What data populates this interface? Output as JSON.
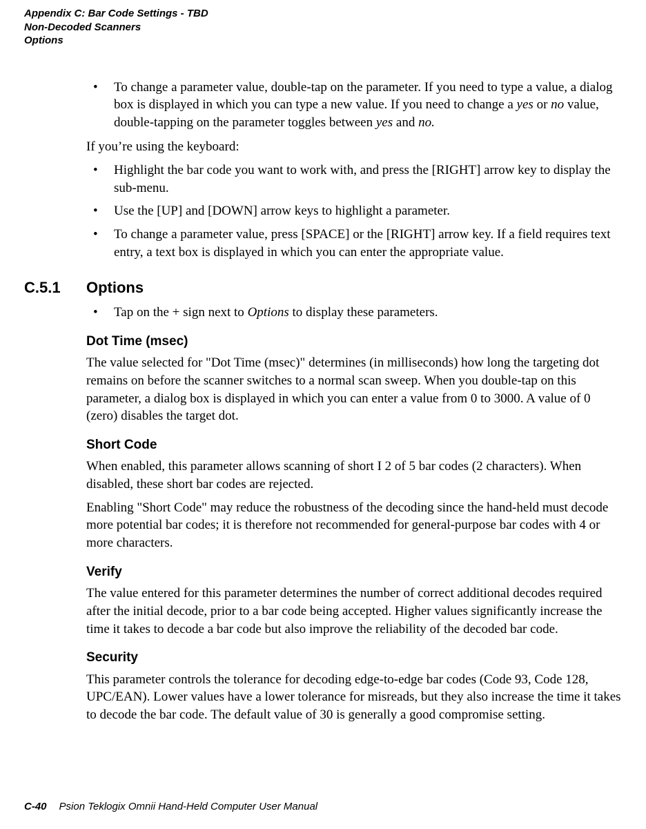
{
  "header": {
    "line1": "Appendix C: Bar Code Settings - TBD",
    "line2": "Non-Decoded Scanners",
    "line3": "Options"
  },
  "body": {
    "top_bullets": [
      {
        "pre": "To change a parameter value, double-tap on the parameter. If you need to type a value, a dialog box is displayed in which you can type a new value. If you need to change a ",
        "em1": "yes",
        "mid1": " or ",
        "em2": "no",
        "mid2": " value, double-tapping on the parameter toggles between ",
        "em3": "yes",
        "mid3": " and ",
        "em4": "no.",
        "post": ""
      }
    ],
    "keyboard_intro": "If you’re using the keyboard:",
    "keyboard_bullets": [
      "Highlight the bar code you want to work with, and press the [RIGHT] arrow key to display the sub-menu.",
      "Use the [UP] and [DOWN] arrow keys to highlight a parameter.",
      "To change a parameter value, press [SPACE] or the [RIGHT] arrow key. If a field requires text entry, a text box is displayed in which you can enter the appropriate value."
    ]
  },
  "section": {
    "number": "C.5.1",
    "title": "Options",
    "intro_bullet": {
      "pre": "Tap on the + sign next to ",
      "em": "Options",
      "post": " to display these parameters."
    },
    "dot_time": {
      "heading": "Dot Time (msec)",
      "para": "The value selected for \"Dot Time (msec)\" determines (in milliseconds) how long the targeting dot remains on before the scanner switches to a normal scan sweep. When you double-tap on this parameter, a dialog box is displayed in which you can enter a value from 0 to 3000. A value of 0 (zero) disables the target dot."
    },
    "short_code": {
      "heading": "Short Code",
      "para1": "When enabled, this parameter allows scanning of short  I 2 of 5 bar codes (2 characters). When disabled, these short bar codes are rejected.",
      "para2": "Enabling \"Short Code\" may reduce the robustness of the decoding since the hand-held must decode more potential bar codes; it is therefore not recommended for general-purpose bar codes with 4 or more characters."
    },
    "verify": {
      "heading": "Verify",
      "para": "The value entered for this parameter determines the number of correct additional decodes required after the initial decode, prior to a bar code being accepted. Higher values significantly increase the time it takes to decode a bar code but also improve the reliability of the decoded bar code."
    },
    "security": {
      "heading": "Security",
      "para": "This parameter controls the tolerance for decoding edge-to-edge bar codes (Code 93, Code 128, UPC/EAN). Lower values have a lower tolerance for misreads, but they also increase the time it takes to decode the bar code. The default value of 30 is generally a good compromise setting."
    }
  },
  "footer": {
    "page_number": "C-40",
    "manual_title": "Psion Teklogix Omnii Hand-Held Computer User Manual"
  }
}
